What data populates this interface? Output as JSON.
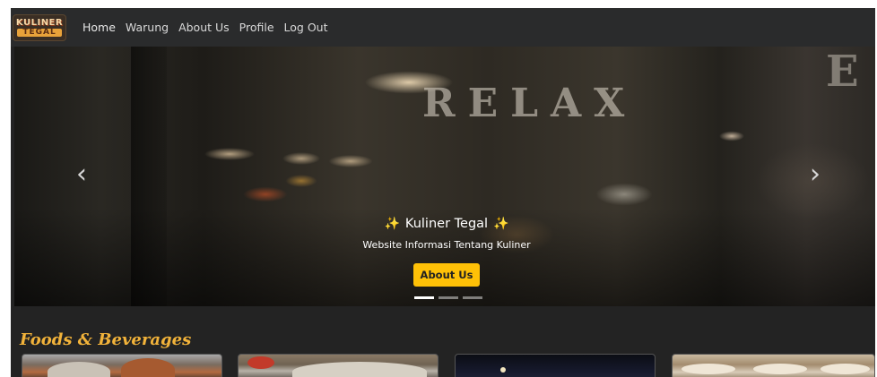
{
  "navbar": {
    "logo": {
      "top_text": "KULINER",
      "bottom_text": "TEGAL"
    },
    "links": [
      {
        "label": "Home"
      },
      {
        "label": "Warung"
      },
      {
        "label": "About Us"
      },
      {
        "label": "Profile"
      },
      {
        "label": "Log Out"
      }
    ]
  },
  "hero": {
    "background_sign_text": "RELAX",
    "background_sign_partial": "E",
    "prev_icon": "chevron-left-icon",
    "next_icon": "chevron-right-icon",
    "prev_glyph": "‹",
    "next_glyph": "›",
    "sparkle_glyph": "✨",
    "caption": {
      "title": "Kuliner Tegal",
      "subtitle": "Website Informasi Tentang Kuliner",
      "button_label": "About Us"
    },
    "slide_count": 3,
    "active_slide": 1
  },
  "section": {
    "title": "Foods & Beverages"
  },
  "colors": {
    "page_bg": "#232323",
    "navbar_bg": "#2a2b2c",
    "accent_button": "#ffc107",
    "section_title": "#f2b33a"
  }
}
